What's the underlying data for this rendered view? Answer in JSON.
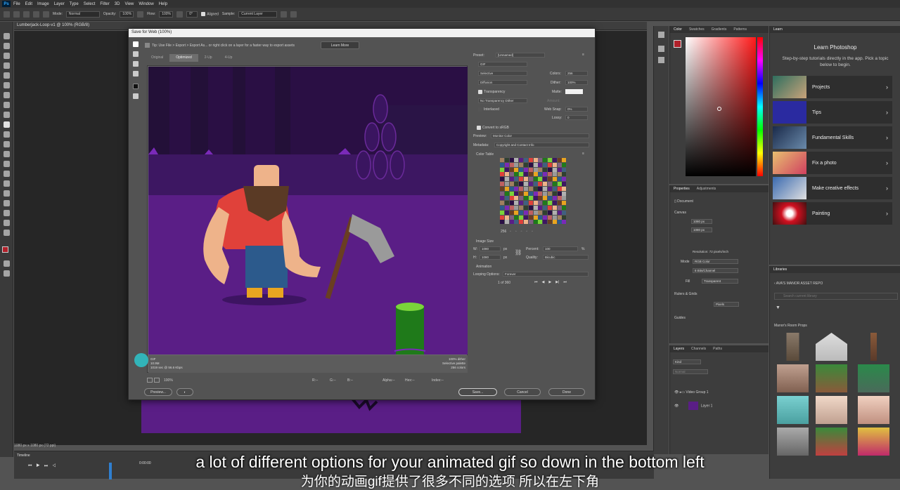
{
  "menubar": {
    "app": "Ps",
    "items": [
      "File",
      "Edit",
      "Image",
      "Layer",
      "Type",
      "Select",
      "Filter",
      "3D",
      "View",
      "Window",
      "Help"
    ]
  },
  "options": {
    "mode_label": "Mode:",
    "mode": "Normal",
    "opacity_label": "Opacity:",
    "opacity": "100%",
    "flow_label": "Flow:",
    "flow": "100%",
    "angle": "0°",
    "aligned": "Aligned",
    "sample_label": "Sample:",
    "sample": "Current Layer"
  },
  "document": {
    "tab": "Lumberjack-Loop-v1 @ 100% (RGB/8)",
    "status": "1080 px x 1080 px (72 ppi)"
  },
  "sfw": {
    "title": "Save for Web (100%)",
    "tip": "Tip: Use File > Export > Export As... or right click on a layer for a faster way to export assets",
    "learn_more": "Learn More",
    "tabs": [
      "Original",
      "Optimized",
      "2-Up",
      "4-Up"
    ],
    "active_tab": "Optimized",
    "preview_left": [
      "GIF",
      "10.9M",
      "1019 sec @ 56.6 Kbps"
    ],
    "preview_right": [
      "100% dither",
      "Selective palette",
      "256 colors"
    ],
    "zoom": "100%",
    "readouts": [
      "R:--",
      "G:--",
      "B:--",
      "Alpha:--",
      "Hex:--",
      "Index:--"
    ],
    "buttons": {
      "preview": "Preview...",
      "save": "Save...",
      "cancel": "Cancel",
      "done": "Done"
    },
    "settings": {
      "preset_label": "Preset:",
      "preset": "[Unnamed]",
      "format": "GIF",
      "reduction": "Selective",
      "colors_label": "Colors:",
      "colors": "256",
      "dither_algo": "Diffusion",
      "dither_label": "Dither:",
      "dither": "100%",
      "transparency": "Transparency",
      "matte_label": "Matte:",
      "trans_dither": "No Transparency Dither",
      "amount_label": "Amount:",
      "interlaced": "Interlaced",
      "websnap_label": "Web Snap:",
      "websnap": "0%",
      "lossy_label": "Lossy:",
      "lossy": "0",
      "convert_srgb": "Convert to sRGB",
      "preview_label": "Preview:",
      "preview": "Monitor Color",
      "metadata_label": "Metadata:",
      "metadata": "Copyright and Contact Info",
      "color_table": "Color Table",
      "ct_count": "256",
      "image_size": "Image Size",
      "w_label": "W:",
      "w": "1080",
      "h_label": "H:",
      "h": "1080",
      "px": "px",
      "percent_label": "Percent:",
      "percent": "100",
      "pct": "%",
      "quality_label": "Quality:",
      "quality": "Bicubic",
      "animation": "Animation",
      "looping_label": "Looping Options:",
      "looping": "Forever",
      "frame": "1 of 360"
    }
  },
  "color_panel": {
    "tabs": [
      "Color",
      "Swatches",
      "Gradients",
      "Patterns"
    ],
    "fg": "#b0202a"
  },
  "properties": {
    "tabs": [
      "Properties",
      "Adjustments"
    ],
    "doc": "Document",
    "canvas": "Canvas",
    "w": "1080 px",
    "h": "1080 px",
    "res": "Resolution: 72 pixels/inch",
    "mode_label": "Mode",
    "mode": "RGB Color",
    "depth": "8 Bits/Channel",
    "fill_label": "Fill",
    "fill": "Transparent",
    "rulers": "Rulers & Grids",
    "units": "Pixels",
    "guides": "Guides"
  },
  "layers": {
    "tabs": [
      "Layers",
      "Channels",
      "Paths"
    ],
    "kind": "Kind",
    "blend": "Normal",
    "group": "Video Group 1",
    "layer": "Layer 1"
  },
  "learn": {
    "tab": "Learn",
    "title": "Learn Photoshop",
    "desc": "Step-by-step tutorials directly in the app. Pick a topic below to begin.",
    "items": [
      "Projects",
      "Tips",
      "Fundamental Skills",
      "Fix a photo",
      "Make creative effects",
      "Painting"
    ]
  },
  "libraries": {
    "tab": "Libraries",
    "name": "AVA'S MANOR ASSET REPO",
    "search": "Search current library",
    "section": "Manor's Room Props"
  },
  "timeline": {
    "tab": "Timeline",
    "time": "0:00:00"
  },
  "subtitle": {
    "line1": "a lot of different options for your animated gif so down in the bottom left",
    "line2": "为你的动画gif提供了很多不同的选项 所以在左下角"
  }
}
